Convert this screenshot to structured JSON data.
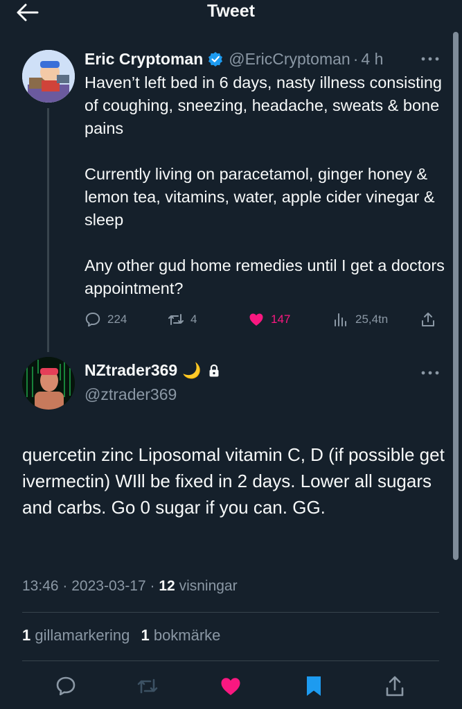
{
  "header": {
    "title": "Tweet"
  },
  "tweet": {
    "author_name": "Eric Cryptoman",
    "handle": "@EricCryptoman",
    "separator": "·",
    "time": "4 h",
    "paragraphs": [
      "Haven’t left bed in 6 days, nasty illness consisting of coughing, sneezing, headache, sweats & bone pains",
      "Currently living on paracetamol, ginger honey & lemon tea, vitamins, water, apple cider vinegar & sleep",
      "Any other gud home remedies until I get a doctors appointment?"
    ],
    "stats": {
      "replies": "224",
      "retweets": "4",
      "likes": "147",
      "views": "25,4tn"
    }
  },
  "reply": {
    "author_name": "NZtrader369",
    "moon": "🌙",
    "handle": "@ztrader369",
    "text": "quercetin zinc Liposomal vitamin C, D (if possible get ivermectin) WIll be fixed in 2 days. Lower all sugars and carbs. Go 0 sugar if you can. GG.",
    "time": "13:46",
    "sep1": "·",
    "date": "2023-03-17",
    "sep2": "·",
    "views_count": "12",
    "views_label": "visningar",
    "likes_count": "1",
    "likes_label": "gillamarkering",
    "bookmarks_count": "1",
    "bookmarks_label": "bokmärke"
  },
  "colors": {
    "background": "#15202b",
    "text": "#f7f9f9",
    "muted": "#8b98a5",
    "like": "#f91880",
    "accent": "#1d9bf0",
    "divider": "#38444d"
  },
  "icons": [
    "back-arrow-icon",
    "verified-badge-icon",
    "more-icon",
    "reply-icon",
    "retweet-icon",
    "like-icon",
    "views-icon",
    "share-icon",
    "moon-emoji",
    "lock-icon",
    "bookmark-icon"
  ]
}
